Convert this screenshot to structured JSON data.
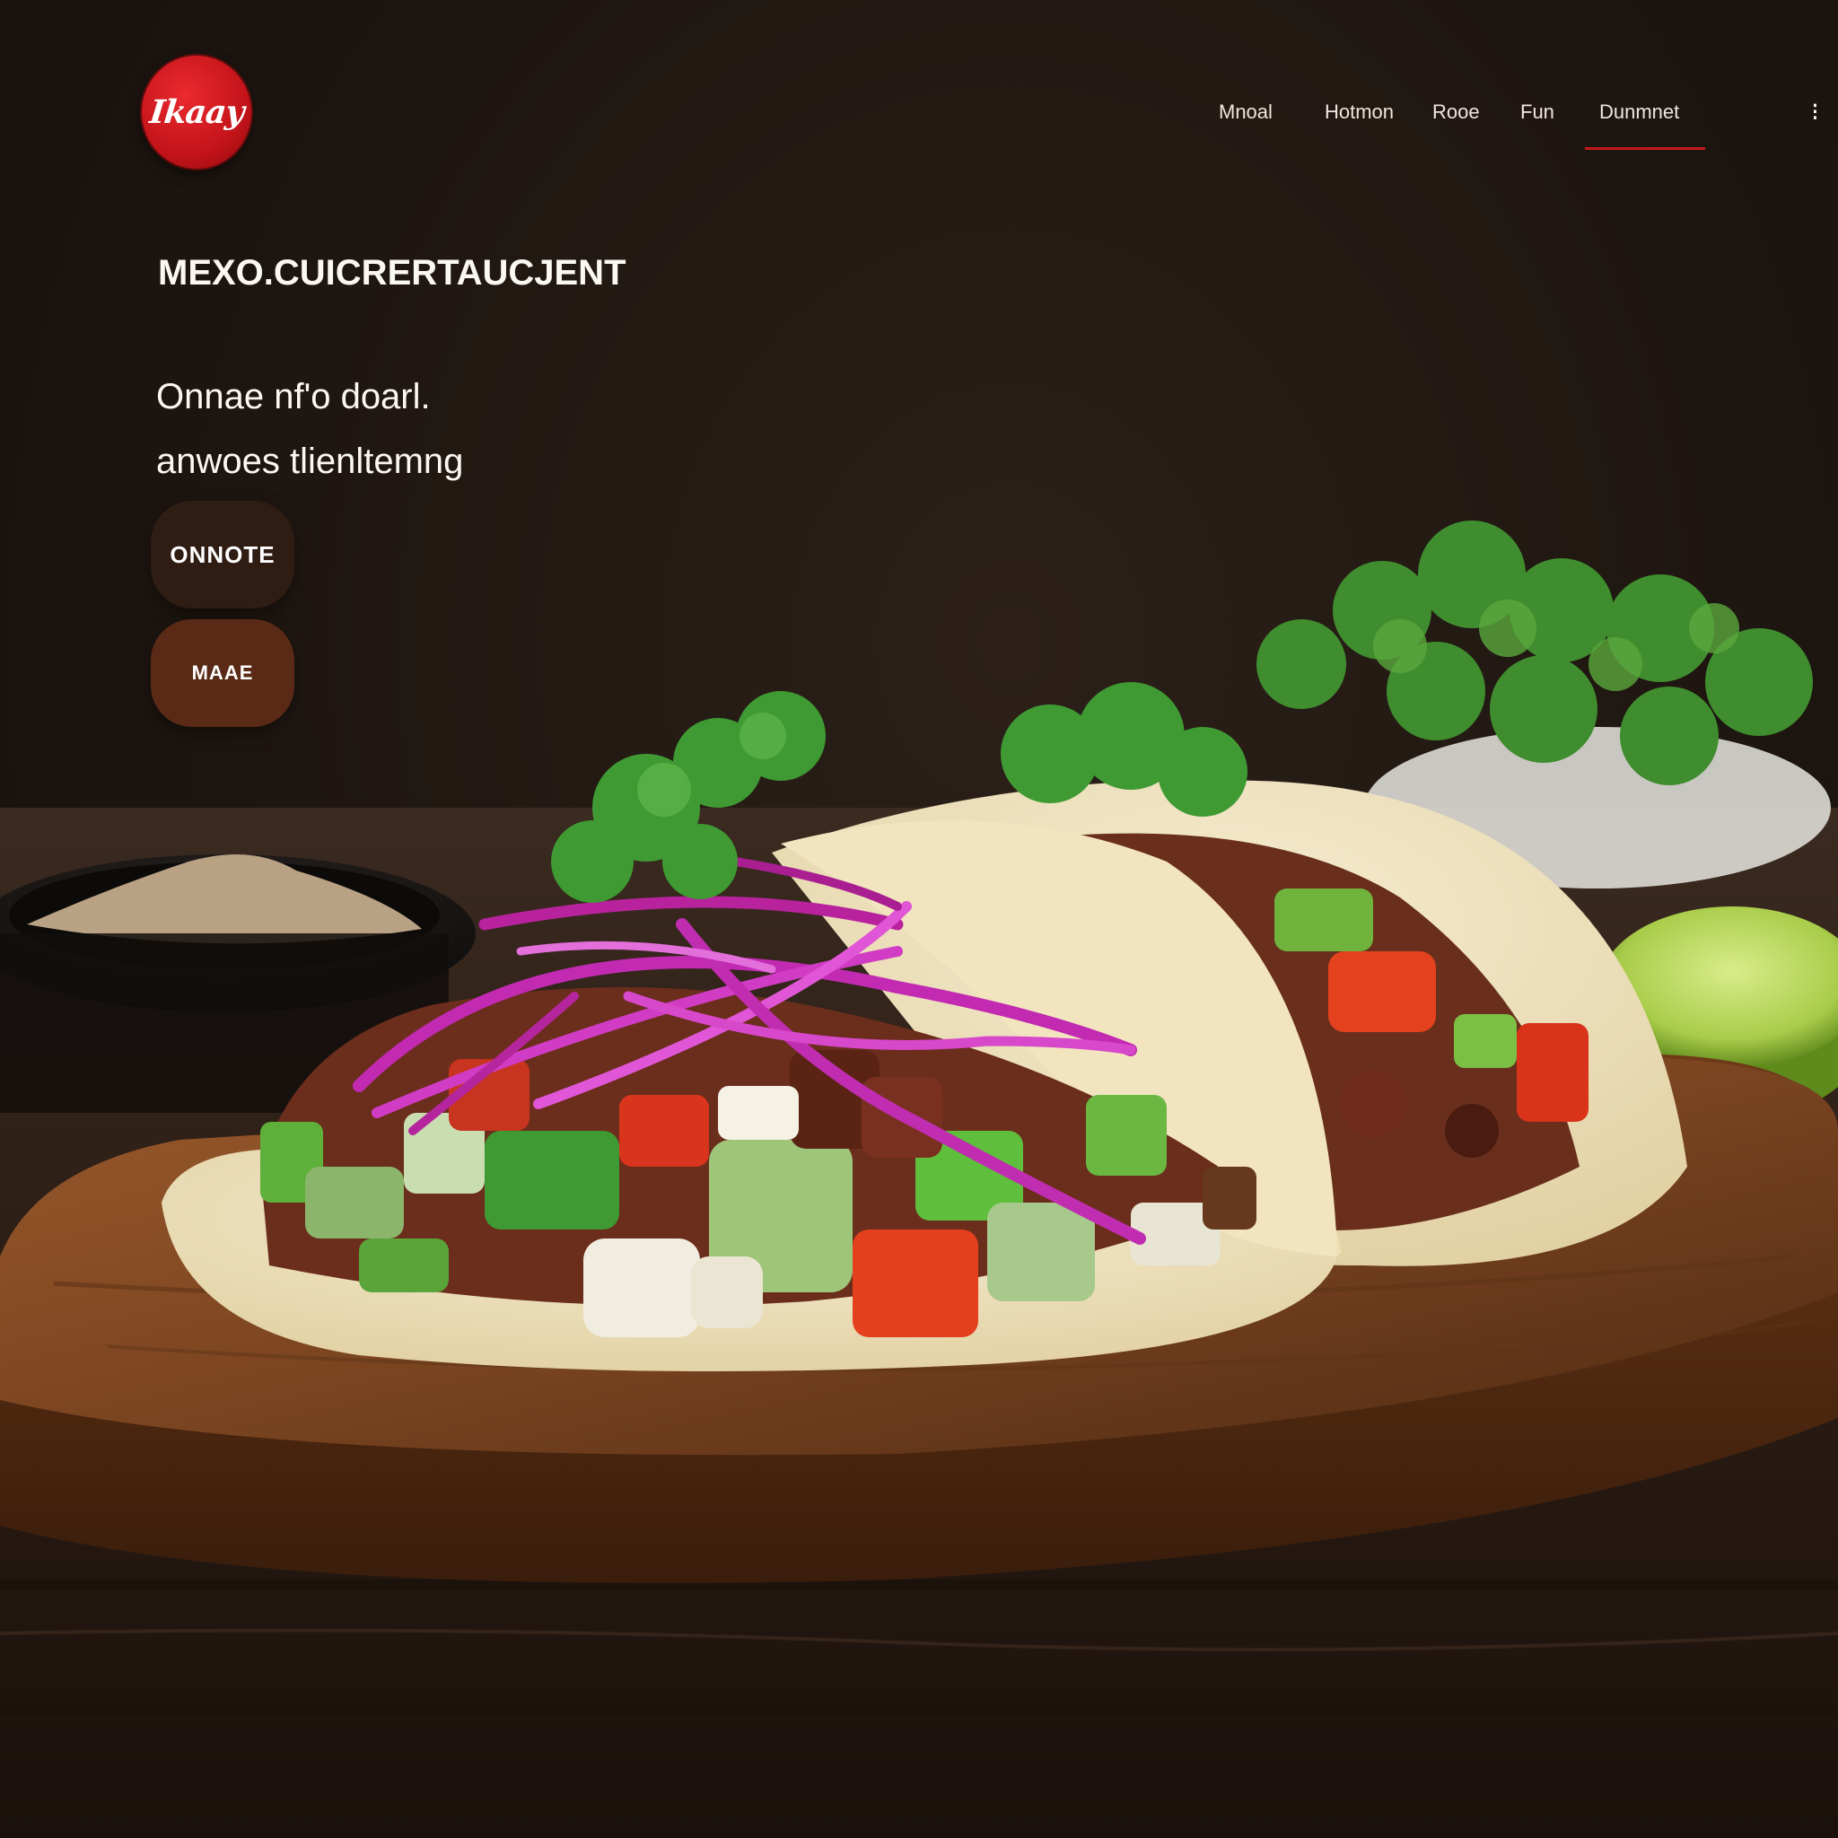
{
  "brand": {
    "logo_text": "Ikaay",
    "logo_color": "#c4141a"
  },
  "nav": {
    "items": [
      {
        "label": "Mnoal"
      },
      {
        "label": "Hotmon"
      },
      {
        "label": "Rooe"
      },
      {
        "label": "Fun"
      },
      {
        "label": "Dunmnet"
      }
    ],
    "active_index": 4,
    "active_color": "#c41a1e",
    "more_label": "⁝"
  },
  "hero": {
    "title": "MEXO.CUICRERTAUCJENT",
    "tagline_line1": "Onnae nf'o doarl.",
    "tagline_line2": "anwoes tlienltemng",
    "primary_button": "ONNOTE",
    "secondary_button": "MAAE"
  },
  "colors": {
    "background": "#1f1510",
    "button_primary": "#2f1c13",
    "button_secondary": "#5a2a16",
    "text": "#fbf7f2"
  }
}
